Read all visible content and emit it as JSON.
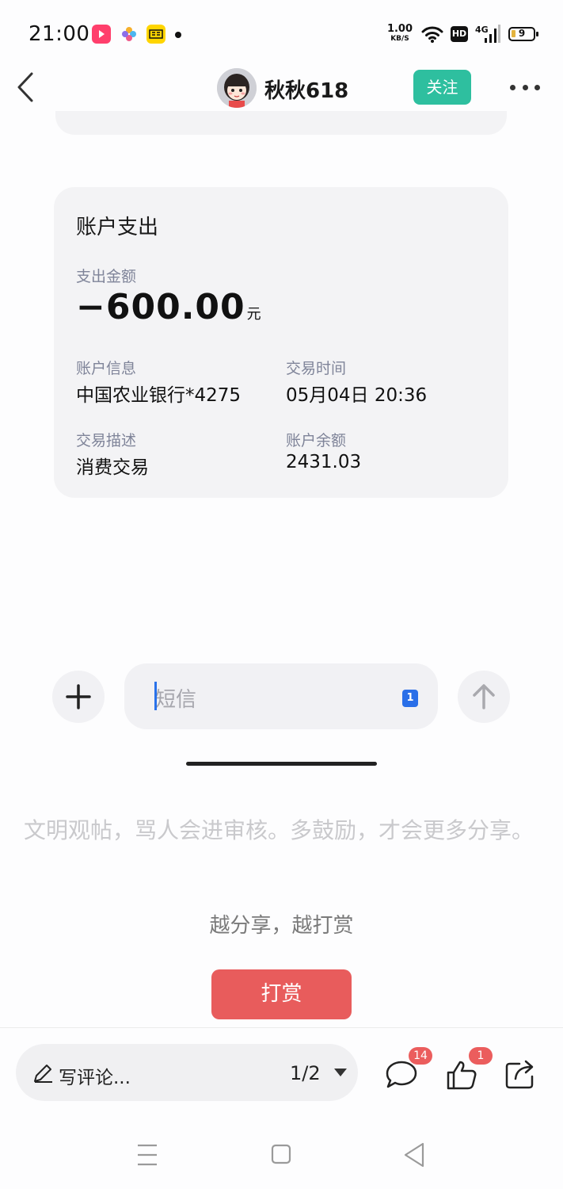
{
  "status_bar": {
    "time": "21:00",
    "net_speed_value": "1.00",
    "net_speed_unit": "KB/S",
    "hd_label": "HD",
    "network_label": "4G",
    "battery_level": "9"
  },
  "header": {
    "username": "秋秋618",
    "follow_label": "关注"
  },
  "card": {
    "title": "账户支出",
    "amount_label": "支出金额",
    "amount": "−600.00",
    "amount_unit": "元",
    "account_info_label": "账户信息",
    "account_info_value": "中国农业银行*4275",
    "time_label": "交易时间",
    "time_value": "05月04日 20:36",
    "desc_label": "交易描述",
    "desc_value": "消费交易",
    "balance_label": "账户余额",
    "balance_value": "2431.03"
  },
  "sms_input": {
    "placeholder": "短信",
    "sim_label": "1"
  },
  "notice": "文明观帖，骂人会进审核。多鼓励，才会更多分享。",
  "reward": {
    "hint": "越分享，越打赏",
    "button_label": "打赏"
  },
  "bottom_bar": {
    "comment_placeholder": "写评论...",
    "page_indicator": "1/2",
    "comment_count": "14",
    "like_count": "1"
  },
  "colors": {
    "accent_green": "#2ebf9f",
    "reward_red": "#e85c5c",
    "badge_red": "#eb5d5d",
    "caret_blue": "#2a72ea"
  }
}
